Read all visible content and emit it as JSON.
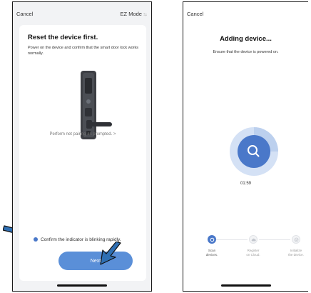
{
  "left_screen": {
    "cancel_label": "Cancel",
    "mode_label": "EZ Mode",
    "mode_icon": "swap-icon",
    "title": "Reset the device first.",
    "description": "Power on the device and confirm that the smart door lock works normally.",
    "pairing_link": "Perform net pairing as prompted. >",
    "confirm_label": "Confirm the indicator is blinking rapidly.",
    "confirm_checked": true,
    "next_label": "Next"
  },
  "right_screen": {
    "cancel_label": "Cancel",
    "title": "Adding device...",
    "description": "Ensure that the device is powered on.",
    "timer": "01:59",
    "steps": [
      {
        "label_line1": "Scan",
        "label_line2": "devices.",
        "active": true,
        "icon": "scan-icon"
      },
      {
        "label_line1": "Register",
        "label_line2": "on Cloud.",
        "active": false,
        "icon": "cloud-icon"
      },
      {
        "label_line1": "Initialize",
        "label_line2": "the device.",
        "active": false,
        "icon": "check-icon"
      }
    ]
  },
  "colors": {
    "accent": "#4a78c9",
    "button": "#5a8fd8",
    "annotation_arrow": "#2f6fb3",
    "scan_ring": "#c9d8f2"
  }
}
